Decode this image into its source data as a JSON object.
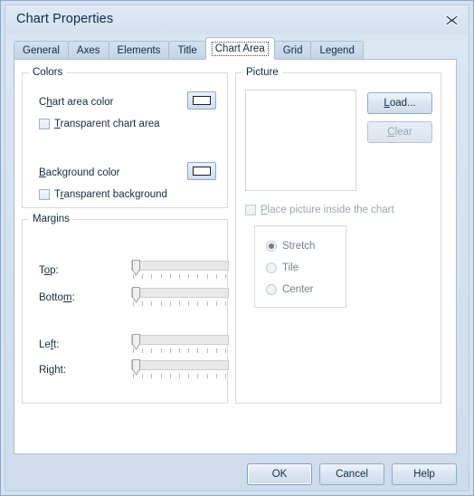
{
  "window": {
    "title": "Chart Properties",
    "close_icon": "close-x-icon"
  },
  "tabs": [
    {
      "label": "General",
      "active": false
    },
    {
      "label": "Axes",
      "active": false
    },
    {
      "label": "Elements",
      "active": false
    },
    {
      "label": "Title",
      "active": false
    },
    {
      "label": "Chart Area",
      "active": true
    },
    {
      "label": "Grid",
      "active": false
    },
    {
      "label": "Legend",
      "active": false
    }
  ],
  "colors_group": {
    "title": "Colors",
    "chart_area_color_label": "Chart area color",
    "chart_area_color_label_pre": "C",
    "chart_area_color_label_accel": "h",
    "chart_area_color_label_post": "art area color",
    "chart_area_color_value": "#ffffff",
    "transparent_chart_area": {
      "accel": "T",
      "rest": "ransparent chart area",
      "checked": false,
      "enabled": true
    },
    "background_color_label_accel": "B",
    "background_color_label_post": "ackground color",
    "background_color_value": "#ffffff",
    "transparent_background": {
      "pre": "T",
      "accel": "r",
      "rest": "ansparent background",
      "checked": false,
      "enabled": true
    }
  },
  "margins_group": {
    "title": "Margins",
    "sliders": [
      {
        "label_pre": "T",
        "label_accel": "o",
        "label_post": "p:",
        "value": 0,
        "min": 0,
        "max": 100,
        "ticks": 11
      },
      {
        "label_pre": "Botto",
        "label_accel": "m",
        "label_post": ":",
        "value": 0,
        "min": 0,
        "max": 100,
        "ticks": 11
      },
      {
        "label_pre": "Le",
        "label_accel": "f",
        "label_post": "t:",
        "value": 0,
        "min": 0,
        "max": 100,
        "ticks": 11
      },
      {
        "label_pre": "Ri",
        "label_accel": "g",
        "label_post": "ht:",
        "value": 0,
        "min": 0,
        "max": 100,
        "ticks": 11
      }
    ]
  },
  "picture_group": {
    "title": "Picture",
    "preview_empty": true,
    "load_button": {
      "accel": "L",
      "rest": "oad...",
      "enabled": true
    },
    "clear_button": {
      "accel": "C",
      "rest": "lear",
      "enabled": false
    },
    "place_inside_checkbox": {
      "accel": "P",
      "rest": "lace picture inside the chart",
      "checked": false,
      "enabled": false
    },
    "mode_options": [
      {
        "label": "Stretch",
        "selected": true,
        "enabled": false
      },
      {
        "label": "Tile",
        "selected": false,
        "enabled": false
      },
      {
        "label": "Center",
        "selected": false,
        "enabled": false
      }
    ]
  },
  "footer": {
    "ok": "OK",
    "cancel": "Cancel",
    "help": "Help",
    "default_button": "OK"
  }
}
